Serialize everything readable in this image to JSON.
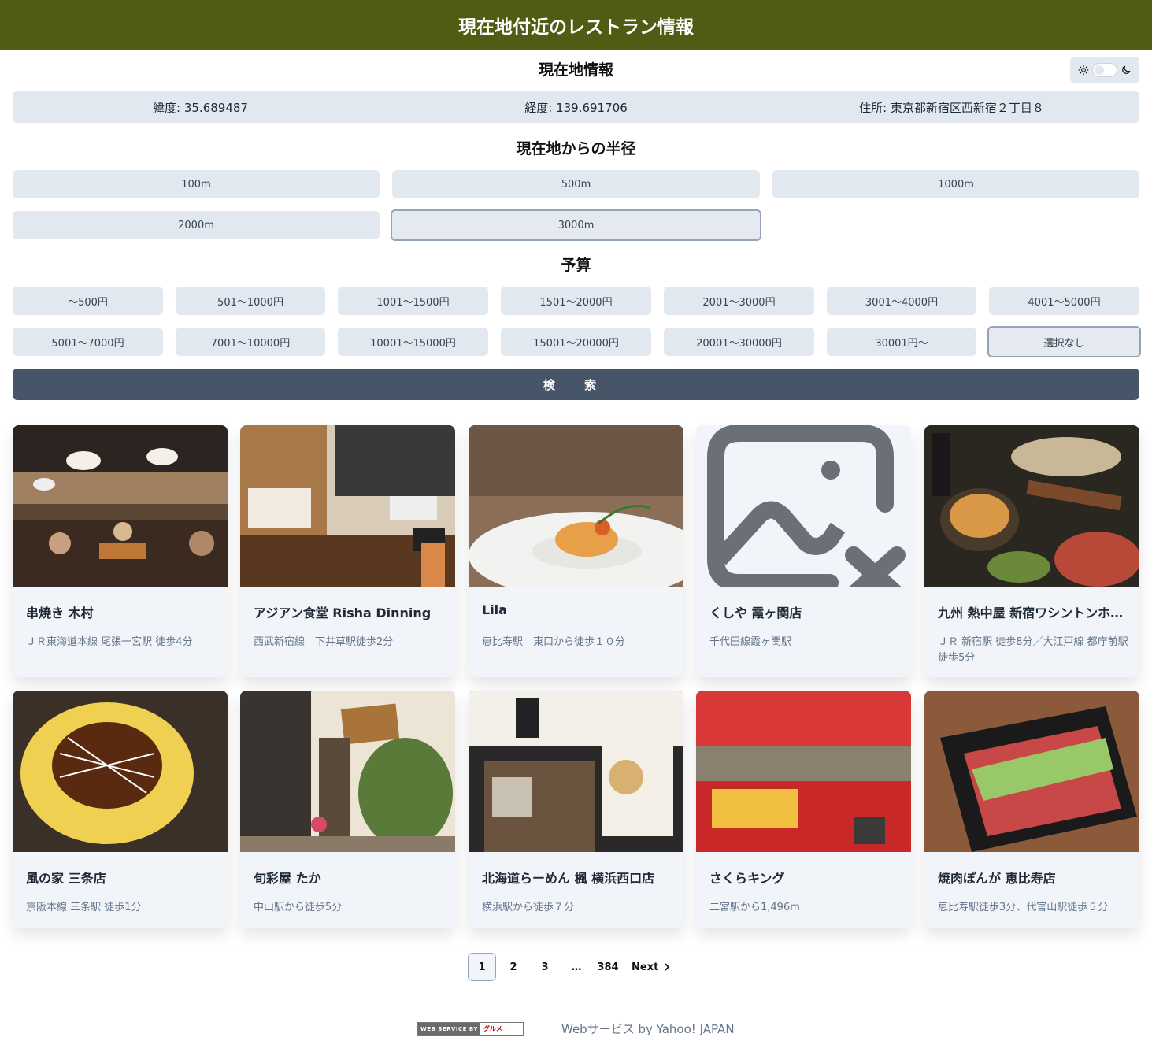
{
  "header": {
    "title": "現在地付近のレストラン情報"
  },
  "location": {
    "title": "現在地情報",
    "latitude": "緯度: 35.689487",
    "longitude": "経度: 139.691706",
    "address": "住所: 東京都新宿区西新宿２丁目８"
  },
  "radius": {
    "title": "現在地からの半径",
    "options": [
      "100m",
      "500m",
      "1000m",
      "2000m",
      "3000m"
    ],
    "selected": "3000m"
  },
  "budget": {
    "title": "予算",
    "options": [
      "〜500円",
      "501〜1000円",
      "1001〜1500円",
      "1501〜2000円",
      "2001〜3000円",
      "3001〜4000円",
      "4001〜5000円",
      "5001〜7000円",
      "7001〜10000円",
      "10001〜15000円",
      "15001〜20000円",
      "20001〜30000円",
      "30001円〜",
      "選択なし"
    ],
    "selected": "選択なし"
  },
  "search": {
    "label": "検 索"
  },
  "restaurants": [
    {
      "name": "串焼き 木村",
      "access": "ＪＲ東海道本線 尾張一宮駅 徒歩4分",
      "image": "restaurant-interior"
    },
    {
      "name": "アジアン食堂 Risha Dinning",
      "access": "西武新宿線　下井草駅徒歩2分",
      "image": "dining-room"
    },
    {
      "name": "Lila",
      "access": "恵比寿駅　東口から徒歩１０分",
      "image": "pasta-dish"
    },
    {
      "name": "くしや 霞ヶ関店",
      "access": "千代田線霞ヶ関駅",
      "image": "missing-image-icon"
    },
    {
      "name": "九州 熱中屋 新宿ワシントンホテル店",
      "access": "ＪＲ 新宿駅 徒歩8分／大江戸線 都庁前駅 徒歩5分",
      "image": "party-food"
    },
    {
      "name": "風の家 三条店",
      "access": "京阪本線 三条駅 徒歩1分",
      "image": "okonomiyaki"
    },
    {
      "name": "旬彩屋 たか",
      "access": "中山駅から徒歩5分",
      "image": "storefront"
    },
    {
      "name": "北海道らーめん 楓 横浜西口店",
      "access": "横浜駅から徒歩７分",
      "image": "ramen-shop"
    },
    {
      "name": "さくらキング",
      "access": "二宮駅から1,496m",
      "image": "sign-board"
    },
    {
      "name": "焼肉ぽんが 恵比寿店",
      "access": "恵比寿駅徒歩3分、代官山駅徒歩５分",
      "image": "beef-tongue"
    }
  ],
  "pagination": {
    "pages": [
      "1",
      "2",
      "3",
      "…",
      "384"
    ],
    "current": "1",
    "next_label": "Next"
  },
  "footer": {
    "badge_left": "WEB SERVICE BY",
    "badge_right": "グルメ",
    "credit": "Webサービス by Yahoo! JAPAN"
  },
  "colors": {
    "header_bg": "#505c14",
    "search_bg": "#475569",
    "button_bg": "#e2e8f0"
  }
}
